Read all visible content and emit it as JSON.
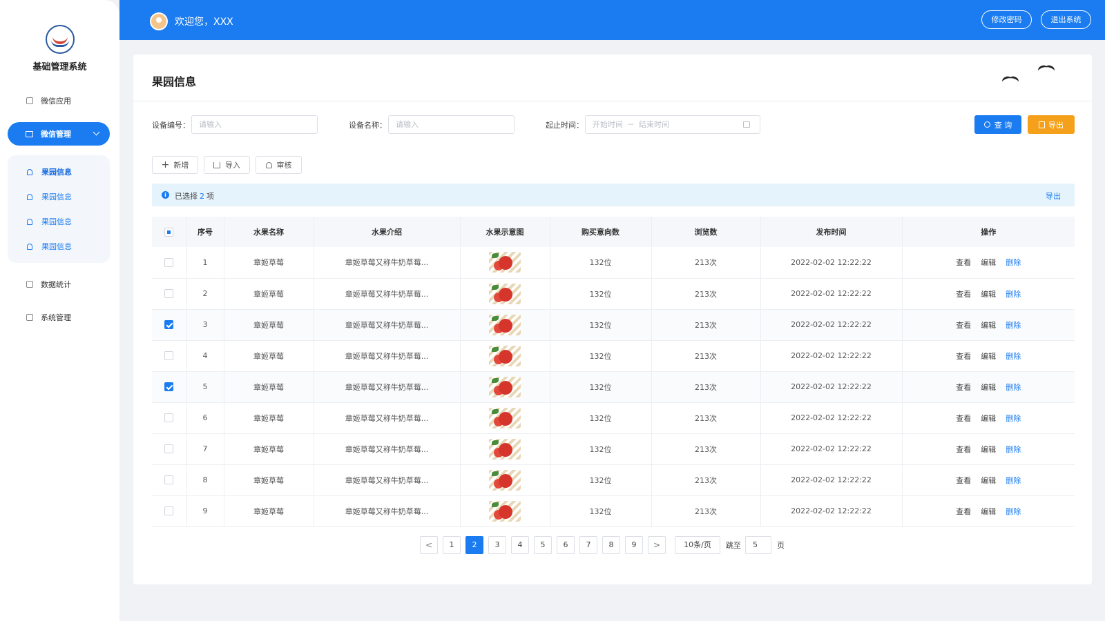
{
  "sidebar": {
    "title": "基础管理系统",
    "items_top": [
      {
        "label": "微信应用",
        "icon": "app-icon"
      }
    ],
    "active": {
      "label": "微信管理",
      "icon": "monitor-icon"
    },
    "submenu": [
      {
        "label": "果园信息",
        "active": true
      },
      {
        "label": "果园信息",
        "active": false
      },
      {
        "label": "果园信息",
        "active": false
      },
      {
        "label": "果园信息",
        "active": false
      }
    ],
    "items_bottom": [
      {
        "label": "数据统计",
        "icon": "chart-icon"
      },
      {
        "label": "系统管理",
        "icon": "settings-doc-icon"
      }
    ]
  },
  "header": {
    "welcome": "欢迎您，XXX",
    "change_password": "修改密码",
    "logout": "退出系统"
  },
  "page": {
    "title": "果园信息"
  },
  "filters": {
    "device_id_label": "设备编号：",
    "device_id_placeholder": "请输入",
    "device_name_label": "设备名称：",
    "device_name_placeholder": "请输入",
    "time_label": "起止时间：",
    "start_placeholder": "开始时间",
    "separator": "－",
    "end_placeholder": "结束时间",
    "query": "查 询",
    "export": "导出"
  },
  "toolbar": {
    "add": "新增",
    "import": "导入",
    "review": "审核"
  },
  "selection": {
    "prefix": "已选择",
    "count": "2",
    "suffix": "项",
    "export": "导出"
  },
  "table": {
    "headers": [
      "序号",
      "水果名称",
      "水果介绍",
      "水果示意图",
      "购买意向数",
      "浏览数",
      "发布时间",
      "操作"
    ],
    "actions": {
      "view": "查看",
      "edit": "编辑",
      "delete": "删除"
    },
    "rows": [
      {
        "no": "1",
        "name": "章姬草莓",
        "intro": "章姬草莓又称牛奶草莓...",
        "intent": "132位",
        "views": "213次",
        "time": "2022-02-02 12:22:22",
        "checked": false
      },
      {
        "no": "2",
        "name": "章姬草莓",
        "intro": "章姬草莓又称牛奶草莓...",
        "intent": "132位",
        "views": "213次",
        "time": "2022-02-02 12:22:22",
        "checked": false
      },
      {
        "no": "3",
        "name": "章姬草莓",
        "intro": "章姬草莓又称牛奶草莓...",
        "intent": "132位",
        "views": "213次",
        "time": "2022-02-02 12:22:22",
        "checked": true
      },
      {
        "no": "4",
        "name": "章姬草莓",
        "intro": "章姬草莓又称牛奶草莓...",
        "intent": "132位",
        "views": "213次",
        "time": "2022-02-02 12:22:22",
        "checked": false
      },
      {
        "no": "5",
        "name": "章姬草莓",
        "intro": "章姬草莓又称牛奶草莓...",
        "intent": "132位",
        "views": "213次",
        "time": "2022-02-02 12:22:22",
        "checked": true
      },
      {
        "no": "6",
        "name": "章姬草莓",
        "intro": "章姬草莓又称牛奶草莓...",
        "intent": "132位",
        "views": "213次",
        "time": "2022-02-02 12:22:22",
        "checked": false
      },
      {
        "no": "7",
        "name": "章姬草莓",
        "intro": "章姬草莓又称牛奶草莓...",
        "intent": "132位",
        "views": "213次",
        "time": "2022-02-02 12:22:22",
        "checked": false
      },
      {
        "no": "8",
        "name": "章姬草莓",
        "intro": "章姬草莓又称牛奶草莓...",
        "intent": "132位",
        "views": "213次",
        "time": "2022-02-02 12:22:22",
        "checked": false
      },
      {
        "no": "9",
        "name": "章姬草莓",
        "intro": "章姬草莓又称牛奶草莓...",
        "intent": "132位",
        "views": "213次",
        "time": "2022-02-02 12:22:22",
        "checked": false
      }
    ]
  },
  "pagination": {
    "prev": "<",
    "next": ">",
    "pages": [
      "1",
      "2",
      "3",
      "4",
      "5",
      "6",
      "7",
      "8",
      "9"
    ],
    "current": "2",
    "page_size": "10条/页",
    "jump_label": "跳至",
    "jump_value": "5",
    "page_unit": "页"
  },
  "colors": {
    "primary": "#1a7cf0",
    "export": "#f5a01a",
    "selection_bg": "#e5f3fd"
  }
}
